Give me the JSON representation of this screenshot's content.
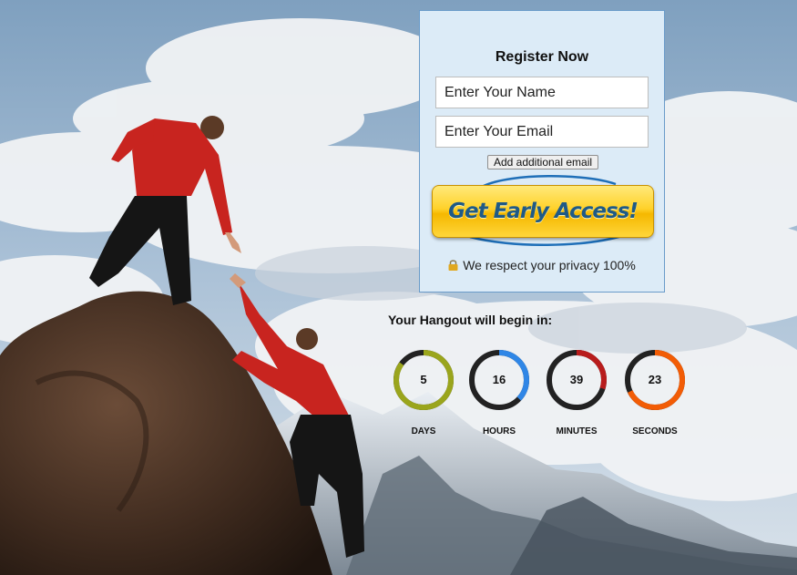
{
  "register": {
    "title": "Register Now",
    "name_placeholder": "Enter Your Name",
    "email_placeholder": "Enter Your Email",
    "add_email_label": "Add additional email",
    "cta_label": "Get Early Access!",
    "privacy_text": "We respect your privacy 100%"
  },
  "countdown": {
    "title": "Your Hangout will begin in:",
    "units": [
      {
        "value": "5",
        "label": "DAYS",
        "color": "#9aa51c",
        "fraction": 0.85
      },
      {
        "value": "16",
        "label": "HOURS",
        "color": "#2f86e6",
        "fraction": 0.37
      },
      {
        "value": "39",
        "label": "MINUTES",
        "color": "#b81c1c",
        "fraction": 0.3
      },
      {
        "value": "23",
        "label": "SECONDS",
        "color": "#f25c05",
        "fraction": 0.68
      }
    ]
  },
  "colors": {
    "panel_bg": "#dcebf7",
    "panel_border": "#6a9bc9",
    "cta_yellow": "#ffd22a",
    "cta_text": "#1f5a86",
    "ring_track": "#222222"
  },
  "icons": {
    "privacy": "lock-icon"
  }
}
